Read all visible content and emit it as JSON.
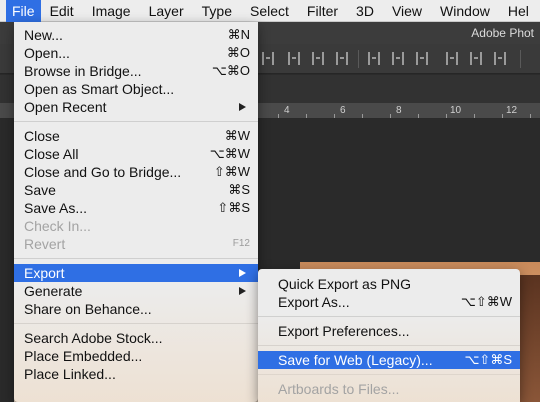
{
  "menubar": {
    "items": [
      {
        "label": "File",
        "active": true
      },
      {
        "label": "Edit"
      },
      {
        "label": "Image"
      },
      {
        "label": "Layer"
      },
      {
        "label": "Type"
      },
      {
        "label": "Select"
      },
      {
        "label": "Filter"
      },
      {
        "label": "3D"
      },
      {
        "label": "View"
      },
      {
        "label": "Window"
      },
      {
        "label": "Hel"
      }
    ]
  },
  "app": {
    "title": "Adobe Phot"
  },
  "ruler": {
    "labels": [
      "4",
      "6",
      "8",
      "10",
      "12"
    ]
  },
  "file_menu": {
    "new": {
      "label": "New...",
      "shortcut": "⌘N"
    },
    "open": {
      "label": "Open...",
      "shortcut": "⌘O"
    },
    "browse": {
      "label": "Browse in Bridge...",
      "shortcut": "⌥⌘O"
    },
    "open_smart": {
      "label": "Open as Smart Object..."
    },
    "open_recent": {
      "label": "Open Recent"
    },
    "close": {
      "label": "Close",
      "shortcut": "⌘W"
    },
    "close_all": {
      "label": "Close All",
      "shortcut": "⌥⌘W"
    },
    "close_bridge": {
      "label": "Close and Go to Bridge...",
      "shortcut": "⇧⌘W"
    },
    "save": {
      "label": "Save",
      "shortcut": "⌘S"
    },
    "save_as": {
      "label": "Save As...",
      "shortcut": "⇧⌘S"
    },
    "check_in": {
      "label": "Check In..."
    },
    "revert": {
      "label": "Revert",
      "shortcut": "F12"
    },
    "export": {
      "label": "Export"
    },
    "generate": {
      "label": "Generate"
    },
    "share_behance": {
      "label": "Share on Behance..."
    },
    "search_stock": {
      "label": "Search Adobe Stock..."
    },
    "place_embedded": {
      "label": "Place Embedded..."
    },
    "place_linked": {
      "label": "Place Linked..."
    }
  },
  "export_menu": {
    "quick_export": {
      "label": "Quick Export as PNG"
    },
    "export_as": {
      "label": "Export As...",
      "shortcut": "⌥⇧⌘W"
    },
    "export_prefs": {
      "label": "Export Preferences..."
    },
    "save_for_web": {
      "label": "Save for Web (Legacy)...",
      "shortcut": "⌥⇧⌘S"
    },
    "artboards": {
      "label": "Artboards to Files..."
    }
  },
  "colors": {
    "highlight": "#2f6fe4",
    "menu_bg": "#ececec",
    "disabled_text": "#a3a3a3"
  }
}
